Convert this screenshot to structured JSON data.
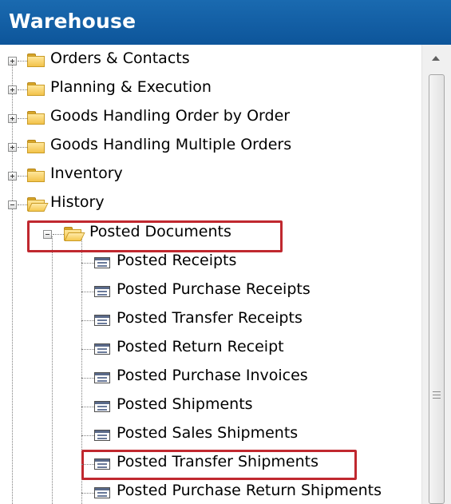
{
  "window": {
    "title": "Warehouse"
  },
  "tree": {
    "folders": [
      {
        "label": "Orders & Contacts",
        "expanded": false
      },
      {
        "label": "Planning & Execution",
        "expanded": false
      },
      {
        "label": "Goods Handling Order by Order",
        "expanded": false
      },
      {
        "label": "Goods Handling Multiple Orders",
        "expanded": false
      },
      {
        "label": "Inventory",
        "expanded": false
      },
      {
        "label": "History",
        "expanded": true
      }
    ],
    "subfolder": {
      "label": "Posted Documents",
      "expanded": true,
      "highlighted": true
    },
    "documents": [
      {
        "label": "Posted Receipts"
      },
      {
        "label": "Posted Purchase Receipts"
      },
      {
        "label": "Posted Transfer Receipts"
      },
      {
        "label": "Posted Return Receipt"
      },
      {
        "label": "Posted Purchase Invoices"
      },
      {
        "label": "Posted Shipments"
      },
      {
        "label": "Posted Sales Shipments"
      },
      {
        "label": "Posted Transfer Shipments",
        "highlighted": true
      },
      {
        "label": "Posted Purchase Return Shipments"
      }
    ]
  },
  "icons": {
    "folder": "folder-icon",
    "open_folder": "folder-open-icon",
    "document": "document-list-icon",
    "expand": "plus-box-icon",
    "collapse": "minus-box-icon",
    "scroll_up": "scroll-up-arrow-icon"
  },
  "colors": {
    "header": "#1461a8",
    "highlight": "#c0282f",
    "folder": "#f2c24a"
  }
}
